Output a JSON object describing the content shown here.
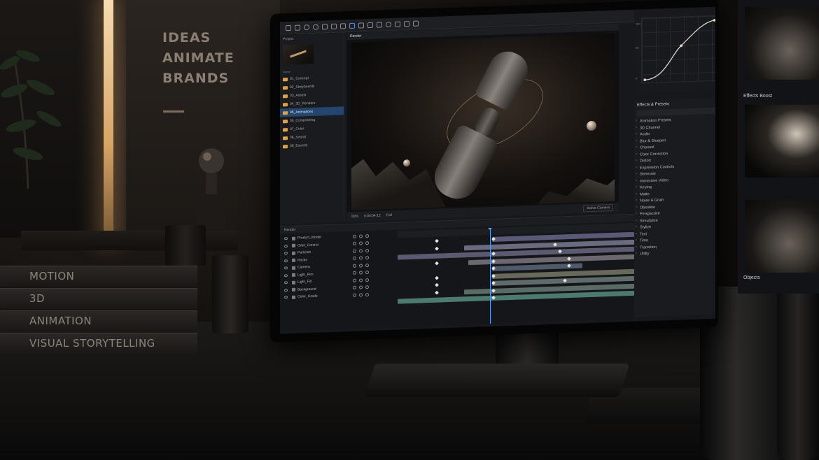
{
  "room": {
    "wall_text": [
      "IDEAS",
      "ANIMATE",
      "BRANDS"
    ],
    "books": [
      "MOTION",
      "3D",
      "ANIMATION",
      "VISUAL STORYTELLING"
    ]
  },
  "app": {
    "project_panel": {
      "tab_label": "Project",
      "folder_header": "Name",
      "folders": [
        {
          "label": "01_Concept"
        },
        {
          "label": "02_Storyboards"
        },
        {
          "label": "03_Assets"
        },
        {
          "label": "04_3D_Renders"
        },
        {
          "label": "05_Animations",
          "selected": true
        },
        {
          "label": "06_Compositing"
        },
        {
          "label": "07_Color"
        },
        {
          "label": "08_Sound"
        },
        {
          "label": "09_Exports"
        }
      ]
    },
    "viewer": {
      "tab_label": "Render",
      "zoom": "50%",
      "timecode": "0:00:04:12",
      "resolution": "Full",
      "camera": "Active Camera"
    },
    "graph_panel": {
      "ticks": [
        "100",
        "50",
        "0"
      ]
    },
    "effects_panel": {
      "title": "Effects & Presets",
      "items": [
        "Animation Presets",
        "3D Channel",
        "Audio",
        "Blur & Sharpen",
        "Channel",
        "Color Correction",
        "Distort",
        "Expression Controls",
        "Generate",
        "Immersive Video",
        "Keying",
        "Matte",
        "Noise & Grain",
        "Obsolete",
        "Perspective",
        "Simulation",
        "Stylize",
        "Text",
        "Time",
        "Transition",
        "Utility"
      ]
    },
    "timeline": {
      "tab_label": "Render",
      "layers": [
        "Product_Model",
        "Orbit_Control",
        "Particles",
        "Rocks",
        "Camera",
        "Light_Rim",
        "Light_Fill",
        "Background",
        "Color_Grade"
      ]
    },
    "side_thumbs": {
      "label_mid": "Effects Boost",
      "label_bottom": "Objects"
    },
    "colors": {
      "accent": "#4a90e2",
      "selection": "#24456e",
      "folder": "#d8a34a",
      "warm_light": "#d8a666"
    }
  }
}
